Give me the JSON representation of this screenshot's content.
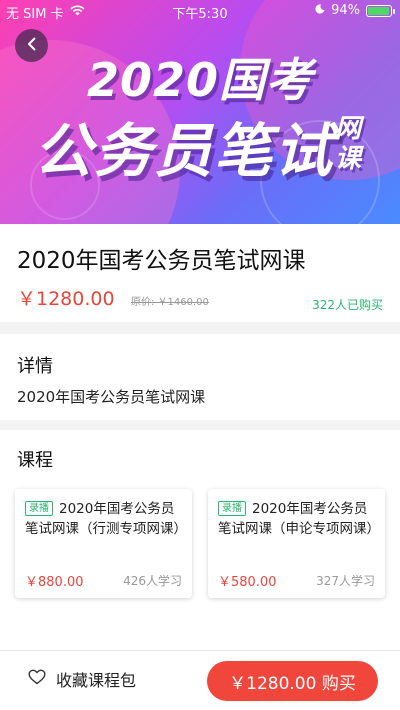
{
  "status_bar": {
    "carrier": "无 SIM 卡",
    "time": "下午5:30",
    "battery": "94%"
  },
  "banner": {
    "line1": "2020国考",
    "line2": "公务员笔试",
    "line2_small": "网课"
  },
  "course_package": {
    "title": "2020年国考公务员笔试网课",
    "price": "￥1280.00",
    "original_price": "原价: ￥1460.00",
    "buyers": "322人已购买"
  },
  "details": {
    "heading": "详情",
    "text": "2020年国考公务员笔试网课"
  },
  "courses": {
    "heading": "课程",
    "items": [
      {
        "tag": "录播",
        "title": "2020年国考公务员笔试网课（行测专项网课）",
        "price": "￥880.00",
        "learners": "426人学习"
      },
      {
        "tag": "录播",
        "title": "2020年国考公务员笔试网课（申论专项网课）",
        "price": "￥580.00",
        "learners": "327人学习"
      }
    ]
  },
  "bottom_bar": {
    "favorite_label": "收藏课程包",
    "buy_label": "￥1280.00 购买"
  },
  "colors": {
    "accent_red": "#f0463c",
    "price_red": "#e8453c",
    "green": "#2bb673"
  }
}
